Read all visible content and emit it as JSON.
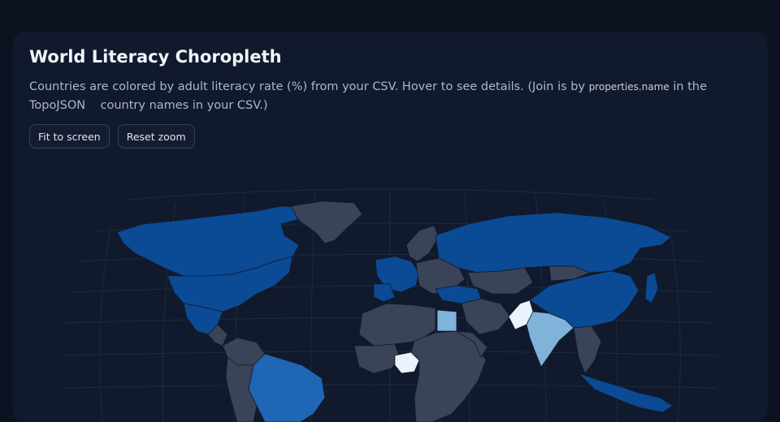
{
  "header": {
    "title": "World Literacy Choropleth",
    "desc_before": "Countries are colored by adult literacy rate (%) from your CSV. Hover to see details. (Join is by ",
    "desc_code": "properties.name",
    "desc_after": " in the TopoJSON    country names in your CSV.)"
  },
  "toolbar": {
    "fit_label": "Fit to screen",
    "reset_label": "Reset zoom"
  },
  "colors": {
    "page_bg": "#0c1220",
    "panel_bg": "#111a2c",
    "no_data": "#3a4358",
    "high": "#0b4a94",
    "mid_high": "#1f66b5",
    "mid": "#7fb3d9",
    "low": "#eaf3fc",
    "grid": "#1f2a40"
  },
  "map": {
    "colored_countries": [
      {
        "name": "North America / USA",
        "class": "high"
      },
      {
        "name": "Mexico",
        "class": "high"
      },
      {
        "name": "Western Europe",
        "class": "high"
      },
      {
        "name": "Russia",
        "class": "high"
      },
      {
        "name": "China",
        "class": "high"
      },
      {
        "name": "Turkey",
        "class": "high"
      },
      {
        "name": "Brazil",
        "class": "mid_high"
      },
      {
        "name": "Indonesia",
        "class": "high"
      },
      {
        "name": "Egypt",
        "class": "mid"
      },
      {
        "name": "India",
        "class": "mid"
      },
      {
        "name": "Pakistan",
        "class": "low"
      },
      {
        "name": "Nigeria",
        "class": "low"
      }
    ]
  }
}
